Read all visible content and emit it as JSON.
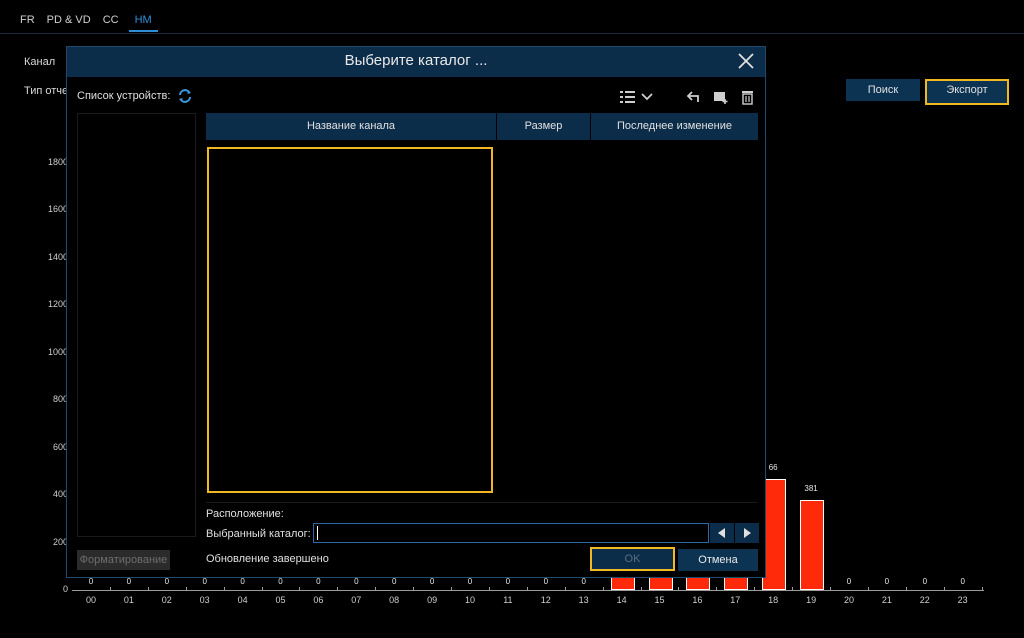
{
  "tabs": [
    "FR",
    "PD & VD",
    "CC",
    "HM"
  ],
  "labels": {
    "channel": "Канал",
    "report_type": "Тип отче"
  },
  "buttons": {
    "search": "Поиск",
    "export": "Экспорт"
  },
  "dialog": {
    "title": "Выберите каталог ...",
    "device_list_label": "Список устройств:",
    "format_button": "Форматирование",
    "columns": [
      "Название канала",
      "Размер",
      "Последнее изменение"
    ],
    "location_label": "Расположение:",
    "selected_dir_label": "Выбранный каталог:",
    "selected_dir_value": "",
    "status": "Обновление завершено",
    "ok": "OK",
    "cancel": "Отмена"
  },
  "colors": {
    "accent": "#2e8fd6",
    "highlight": "#f0b923",
    "bar": "#ff2a0a",
    "panel": "#0c2d49"
  },
  "chart_data": {
    "type": "bar",
    "categories": [
      "00",
      "01",
      "02",
      "03",
      "04",
      "05",
      "06",
      "07",
      "08",
      "09",
      "10",
      "11",
      "12",
      "13",
      "14",
      "15",
      "16",
      "17",
      "18",
      "19",
      "20",
      "21",
      "22",
      "23"
    ],
    "values": [
      0,
      0,
      0,
      0,
      0,
      0,
      0,
      0,
      0,
      0,
      0,
      0,
      0,
      0,
      null,
      null,
      null,
      null,
      466,
      381,
      0,
      0,
      0,
      0
    ],
    "value_labels": [
      "0",
      "0",
      "0",
      "0",
      "0",
      "0",
      "0",
      "0",
      "0",
      "0",
      "0",
      "0",
      "0",
      "0",
      "",
      "",
      "",
      "",
      "66",
      "381",
      "0",
      "0",
      "0",
      "0"
    ],
    "yticks": [
      0,
      200,
      400,
      600,
      800,
      1000,
      1200,
      1400,
      1600,
      1800
    ],
    "ylim": [
      0,
      1900
    ],
    "grid": false
  }
}
